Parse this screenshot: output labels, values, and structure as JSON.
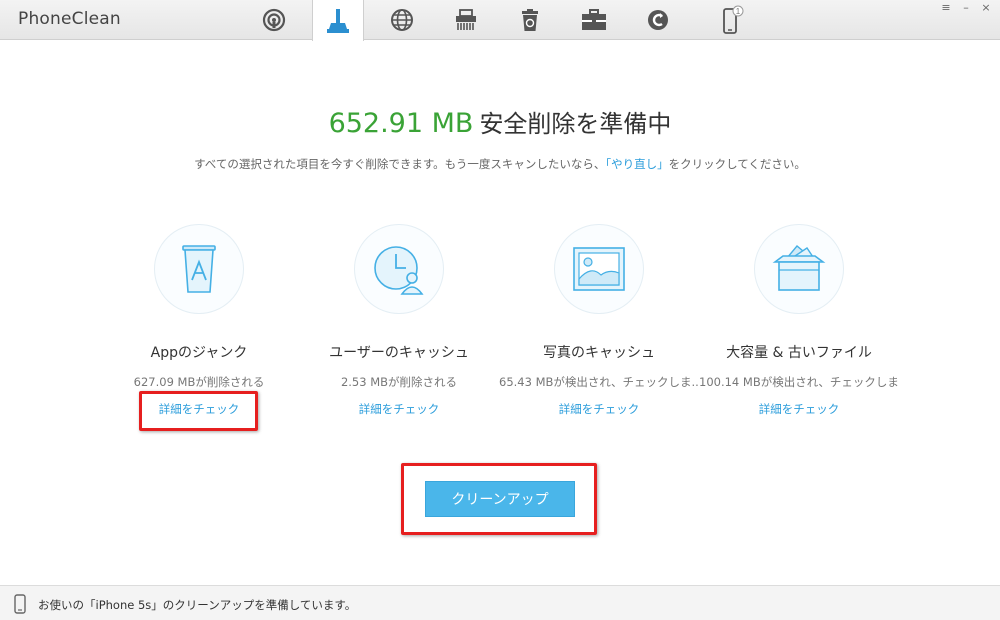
{
  "app": {
    "title": "PhoneClean"
  },
  "toolbar": {
    "tabs": [
      {
        "icon": "quick-clean-icon"
      },
      {
        "icon": "broom-clean-icon",
        "active": true
      },
      {
        "icon": "internet-icon"
      },
      {
        "icon": "shredder-icon"
      },
      {
        "icon": "recycle-bin-icon"
      },
      {
        "icon": "toolbox-icon"
      },
      {
        "icon": "backup-icon"
      },
      {
        "icon": "device-icon",
        "badge": "1"
      }
    ],
    "window_controls": {
      "menu": "≡",
      "minimize": "–",
      "close": "×"
    }
  },
  "header": {
    "amount": "652.91 MB",
    "title_suffix": "安全削除を準備中",
    "sub_before": "すべての選択された項目を今すぐ削除できます。もう一度スキャンしたいなら、",
    "sub_link": "「やり直し」",
    "sub_after": "をクリックしてください。"
  },
  "categories": [
    {
      "icon": "app-junk-icon",
      "title": "Appのジャンク",
      "info": "627.09 MBが削除される",
      "link": "詳細をチェック"
    },
    {
      "icon": "user-cache-icon",
      "title": "ユーザーのキャッシュ",
      "info": "2.53 MBが削除される",
      "link": "詳細をチェック"
    },
    {
      "icon": "photo-cache-icon",
      "title": "写真のキャッシュ",
      "info": "65.43 MBが検出され、チェックしま...",
      "link": "詳細をチェック"
    },
    {
      "icon": "large-old-files-icon",
      "title": "大容量 & 古いファイル",
      "info": "100.14 MBが検出され、チェックしま...",
      "link": "詳細をチェック"
    }
  ],
  "actions": {
    "clean_up": "クリーンアップ"
  },
  "status": {
    "text": "お使いの「iPhone 5s」のクリーンアップを準備しています。"
  },
  "colors": {
    "accent": "#2b9ddb",
    "amount_green": "#3aa336",
    "button": "#4ab6ea",
    "highlight": "#e61f1f"
  }
}
